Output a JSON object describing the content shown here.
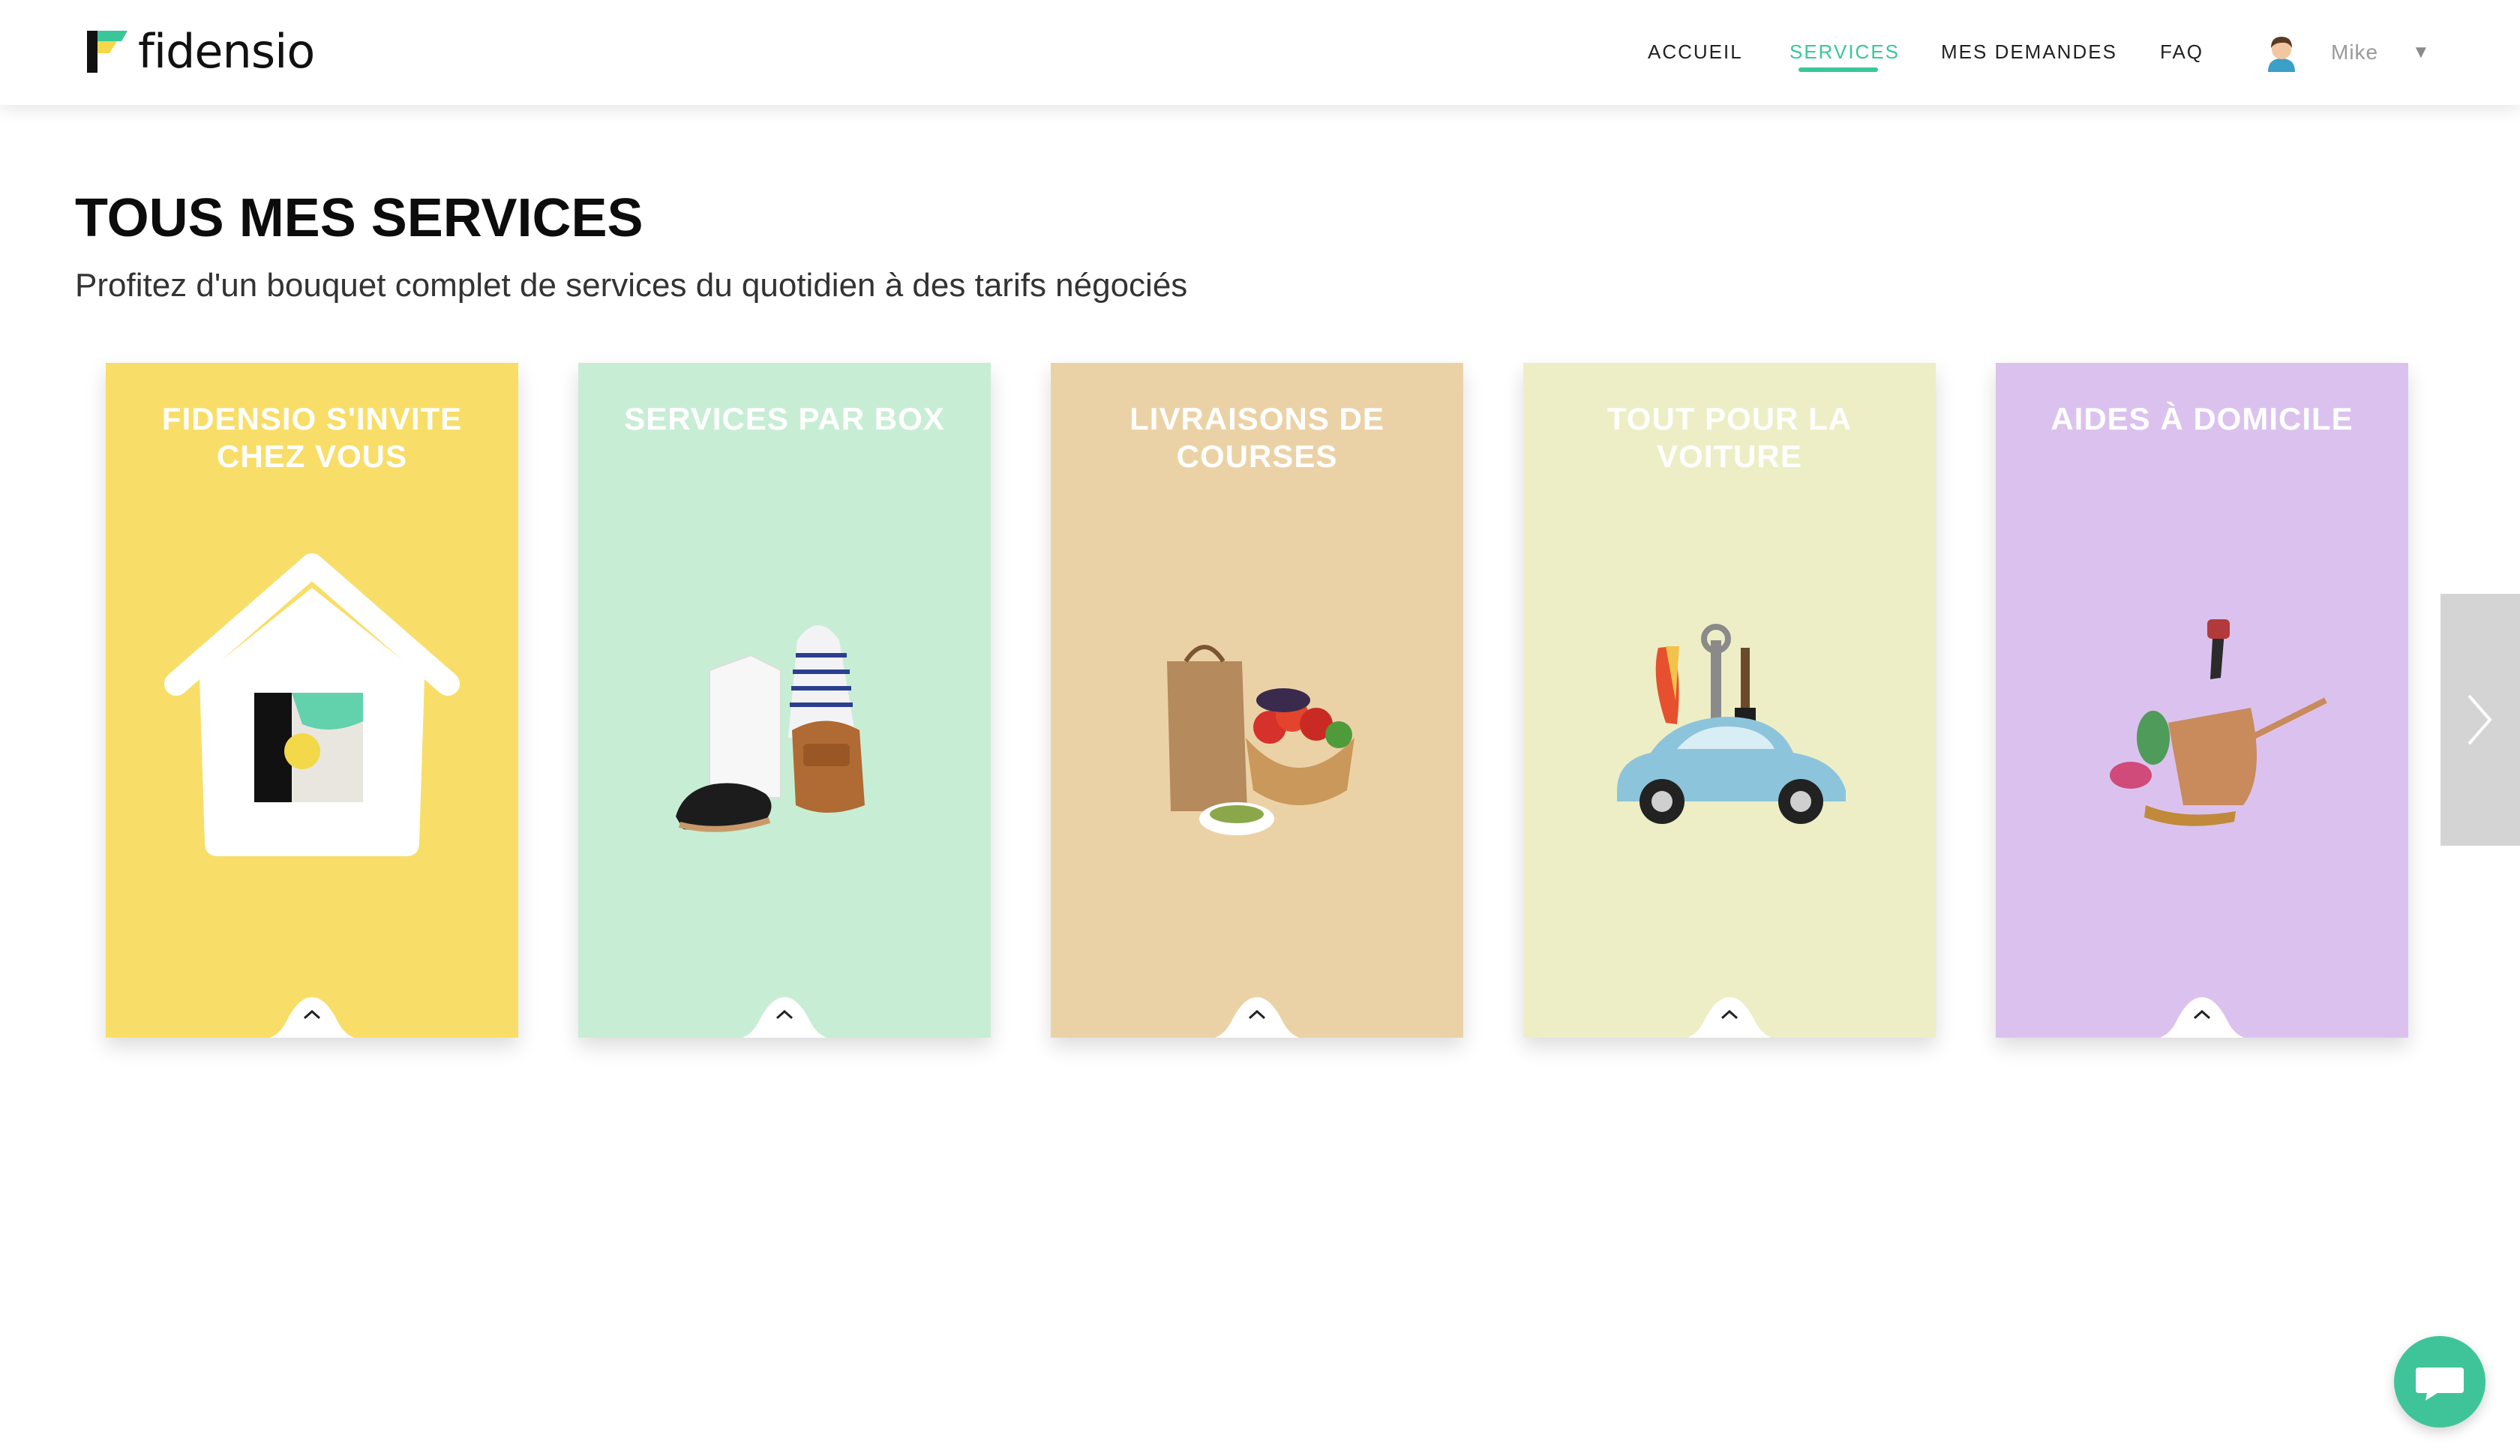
{
  "brand": {
    "name": "fidensio"
  },
  "nav": {
    "items": [
      {
        "label": "ACCUEIL",
        "active": false
      },
      {
        "label": "SERVICES",
        "active": true
      },
      {
        "label": "MES DEMANDES",
        "active": false
      },
      {
        "label": "FAQ",
        "active": false
      }
    ],
    "user": {
      "name": "Mike"
    }
  },
  "page": {
    "title": "TOUS MES SERVICES",
    "subtitle": "Profitez d'un bouquet complet de services du quotidien à des tarifs négociés"
  },
  "cards": [
    {
      "title": "FIDENSIO S'INVITE CHEZ VOUS",
      "color": "#f8de68",
      "icon": "house-logo-icon"
    },
    {
      "title": "SERVICES PAR BOX",
      "color": "#c8edd5",
      "icon": "clothes-shoes-bag-icon"
    },
    {
      "title": "LIVRAISONS DE COURSES",
      "color": "#ebd2a6",
      "icon": "grocery-basket-icon"
    },
    {
      "title": "TOUT POUR LA VOITURE",
      "color": "#eeeec6",
      "icon": "car-tools-icon"
    },
    {
      "title": "AIDES À DOMICILE",
      "color": "#dbc2ee",
      "icon": "garden-tools-icon"
    }
  ],
  "colors": {
    "accent": "#39c79a",
    "chat": "#3fc49a"
  }
}
